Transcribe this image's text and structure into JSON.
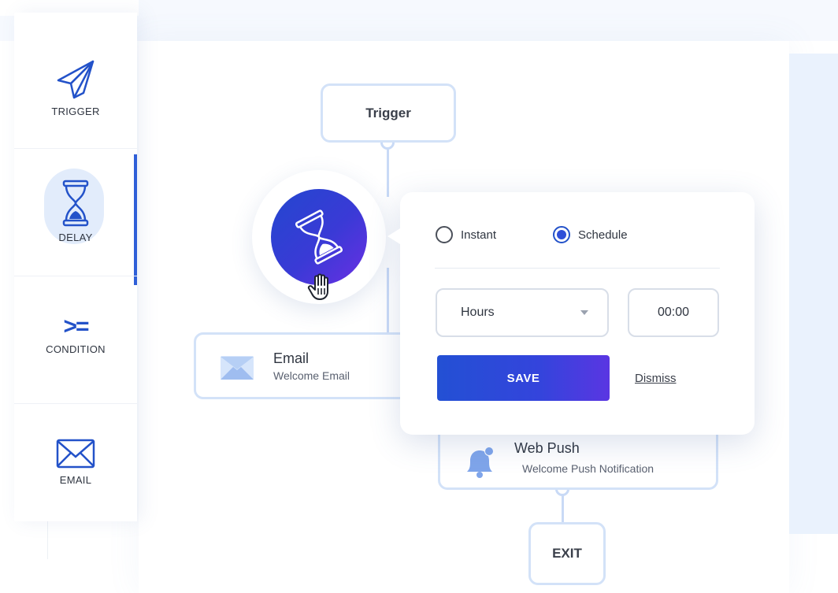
{
  "sidebar": {
    "items": [
      {
        "label": "TRIGGER",
        "icon": "paper-plane-icon"
      },
      {
        "label": "DELAY",
        "icon": "hourglass-icon"
      },
      {
        "label": "CONDITION",
        "icon": "greater-equal-icon",
        "glyph": ">="
      },
      {
        "label": "EMAIL",
        "icon": "envelope-icon"
      }
    ],
    "active": "DELAY"
  },
  "flow": {
    "trigger": {
      "title": "Trigger"
    },
    "email": {
      "title": "Email",
      "subtitle": "Welcome Email",
      "icon": "envelope-icon"
    },
    "webpush": {
      "title": "Web Push",
      "subtitle": "Welcome Push Notification",
      "icon": "bell-icon"
    },
    "exit": {
      "title": "EXIT"
    }
  },
  "delay_popup": {
    "options": [
      {
        "label": "Instant",
        "selected": false
      },
      {
        "label": "Schedule",
        "selected": true
      }
    ],
    "unit_select": {
      "value": "Hours"
    },
    "time_input": {
      "value": "00:00"
    },
    "save_label": "SAVE",
    "dismiss_label": "Dismiss"
  },
  "colors": {
    "accent": "#2352c9",
    "gradient_start": "#2347cf",
    "gradient_end": "#6a2fe3",
    "line": "#c9daf6"
  }
}
